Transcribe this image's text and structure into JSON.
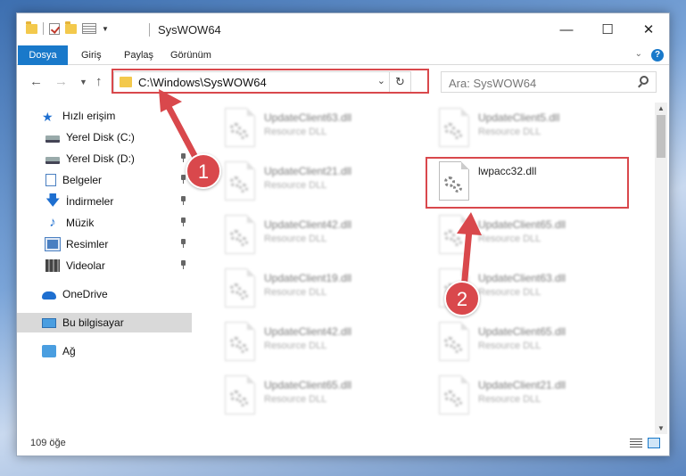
{
  "window": {
    "title": "SysWOW64",
    "controls": {
      "minimize": "—",
      "maximize": "☐",
      "close": "✕"
    }
  },
  "ribbon": {
    "tabs": [
      "Dosya",
      "Giriş",
      "Paylaş",
      "Görünüm"
    ]
  },
  "navbar": {
    "address": "C:\\Windows\\SysWOW64",
    "search_placeholder": "Ara: SysWOW64"
  },
  "nav_pane": {
    "items": [
      {
        "label": "Hızlı erişim",
        "icon": "star-icon"
      },
      {
        "label": "Yerel Disk (C:)",
        "icon": "disk-icon"
      },
      {
        "label": "Yerel Disk (D:)",
        "icon": "disk-icon"
      },
      {
        "label": "Belgeler",
        "icon": "documents-icon"
      },
      {
        "label": "İndirmeler",
        "icon": "download-icon"
      },
      {
        "label": "Müzik",
        "icon": "music-icon"
      },
      {
        "label": "Resimler",
        "icon": "pictures-icon"
      },
      {
        "label": "Videolar",
        "icon": "video-icon"
      },
      {
        "label": "OneDrive",
        "icon": "cloud-icon"
      },
      {
        "label": "Bu bilgisayar",
        "icon": "computer-icon"
      },
      {
        "label": "Ağ",
        "icon": "network-icon"
      }
    ]
  },
  "files": [
    {
      "name": "UpdateClient63.dll",
      "type": "Resource DLL"
    },
    {
      "name": "UpdateClient5.dll",
      "type": "Resource DLL"
    },
    {
      "name": "UpdateClient21.dll",
      "type": "Resource DLL"
    },
    {
      "name": "lwpacc32.dll",
      "type": ""
    },
    {
      "name": "UpdateClient42.dll",
      "type": "Resource DLL"
    },
    {
      "name": "UpdateClient65.dll",
      "type": "Resource DLL"
    },
    {
      "name": "UpdateClient19.dll",
      "type": "Resource DLL"
    },
    {
      "name": "UpdateClient63.dll",
      "type": "Resource DLL"
    },
    {
      "name": "UpdateClient42.dll",
      "type": "Resource DLL"
    },
    {
      "name": "UpdateClient65.dll",
      "type": "Resource DLL"
    },
    {
      "name": "UpdateClient65.dll",
      "type": "Resource DLL"
    },
    {
      "name": "UpdateClient21.dll",
      "type": "Resource DLL"
    }
  ],
  "status": {
    "item_count": "109 öğe"
  },
  "callouts": [
    "1",
    "2"
  ],
  "colors": {
    "accent": "#1979ca",
    "highlight": "#d9484c"
  }
}
